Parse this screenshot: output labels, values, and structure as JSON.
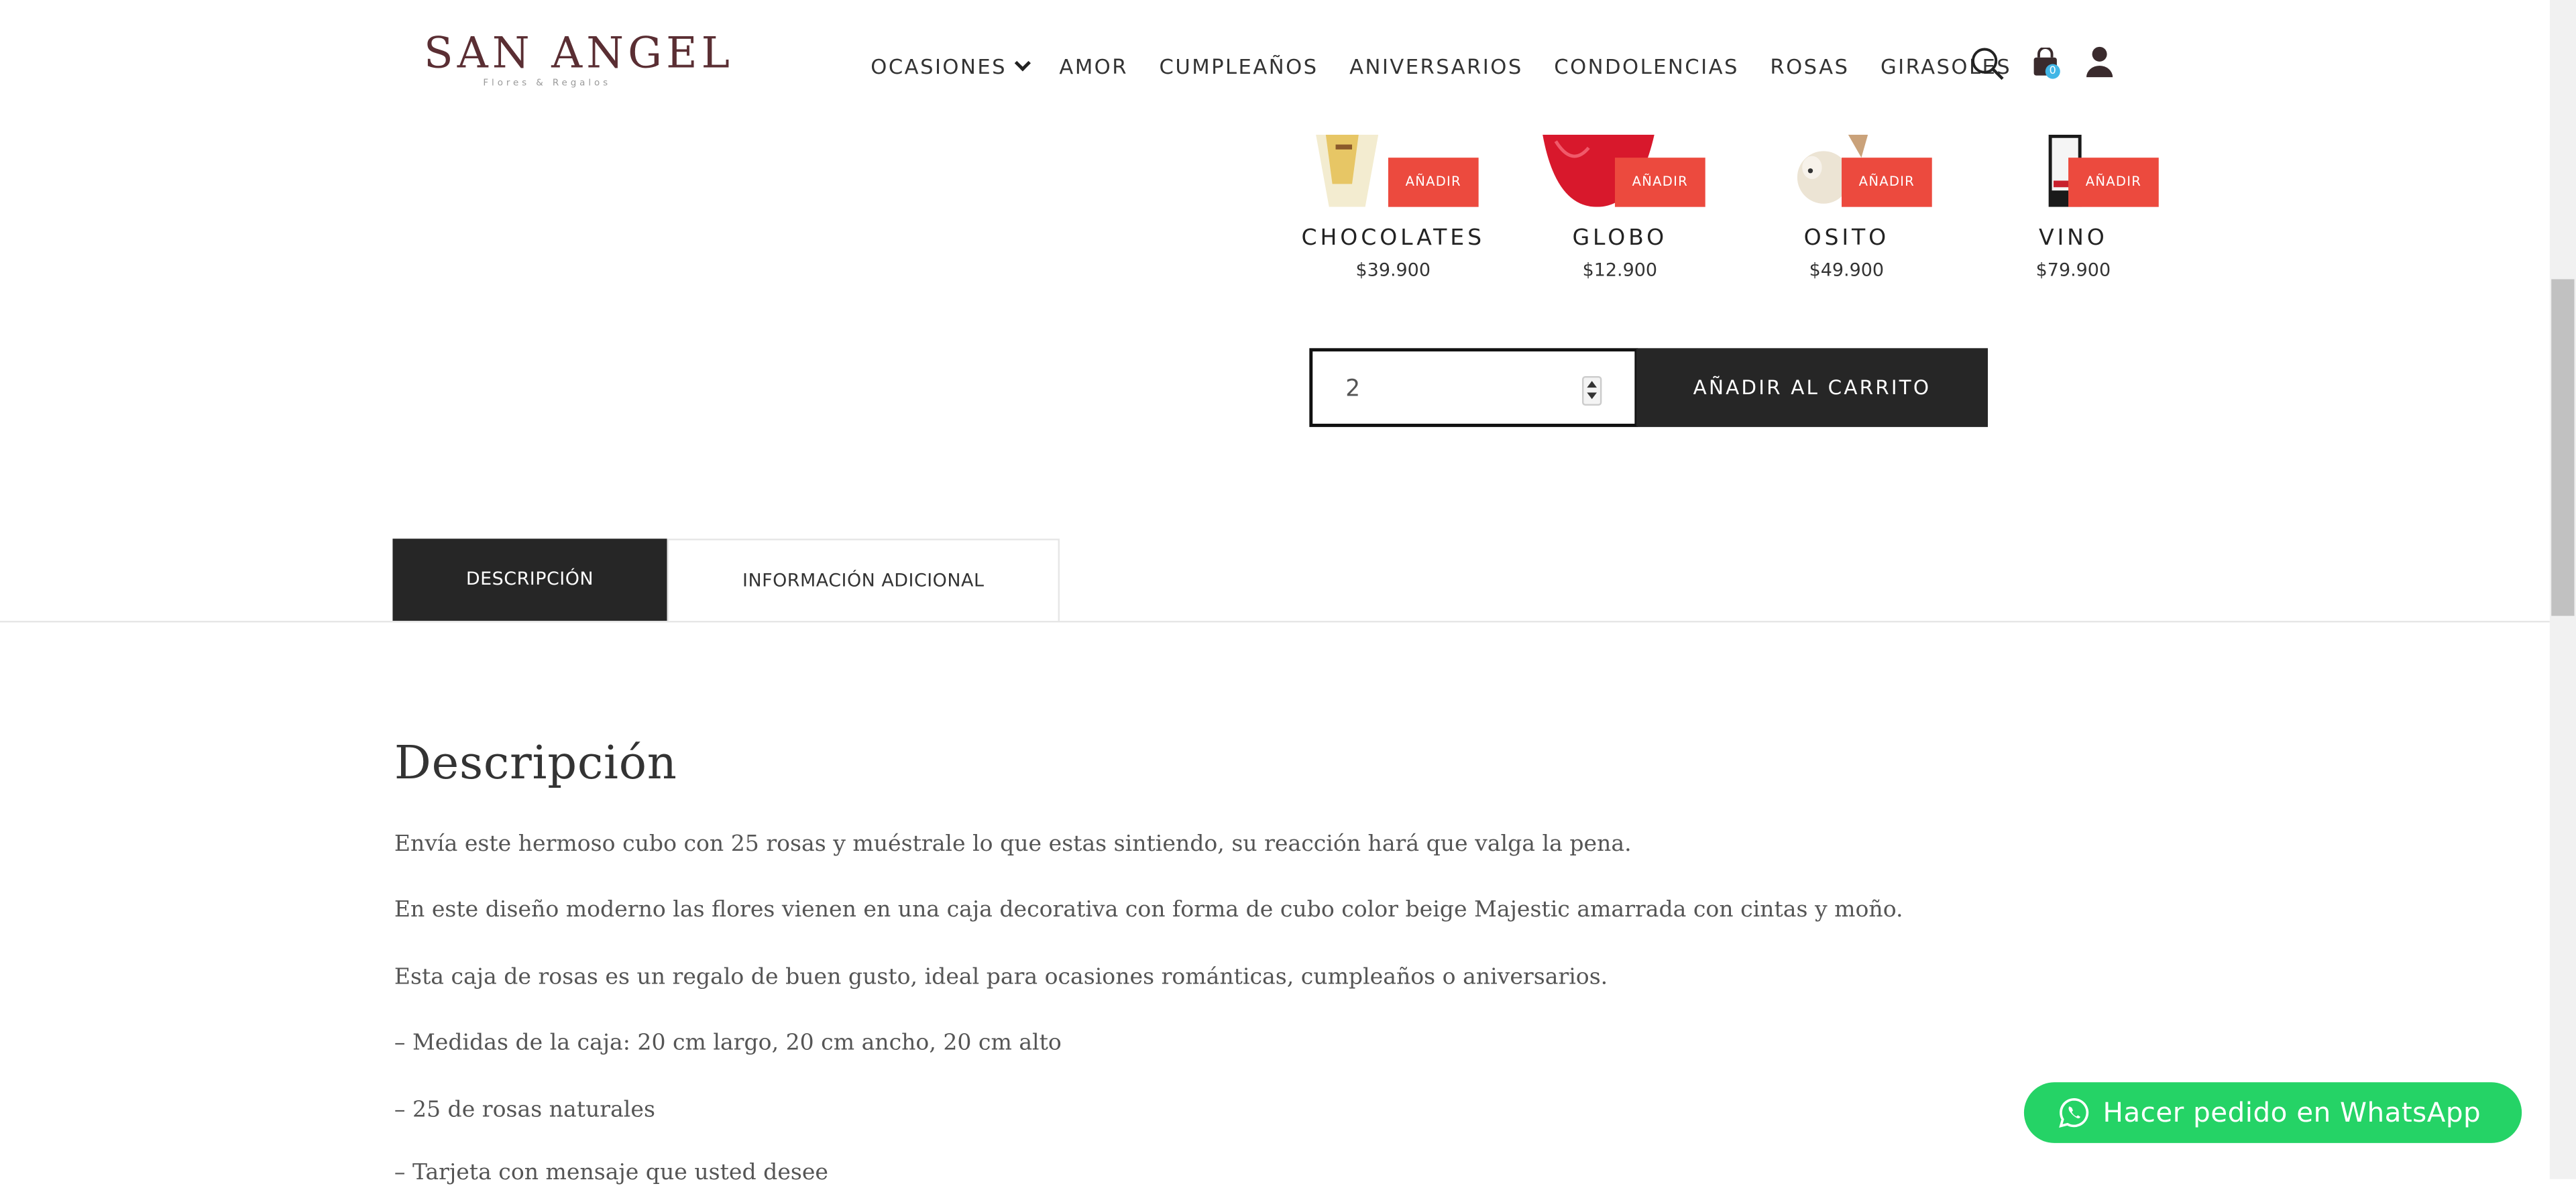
{
  "header": {
    "logo_main": "SAN ANGEL",
    "logo_sub": "Flores & Regalos",
    "nav": [
      "OCASIONES",
      "AMOR",
      "CUMPLEAÑOS",
      "ANIVERSARIOS",
      "CONDOLENCIAS",
      "ROSAS",
      "GIRASOLES"
    ],
    "cart_count": "0",
    "icons": [
      "search-icon",
      "cart-icon",
      "user-icon"
    ]
  },
  "addons": [
    {
      "name": "CHOCOLATES",
      "price": "$39.900",
      "button": "AÑADIR"
    },
    {
      "name": "GLOBO",
      "price": "$12.900",
      "button": "AÑADIR"
    },
    {
      "name": "OSITO",
      "price": "$49.900",
      "button": "AÑADIR"
    },
    {
      "name": "VINO",
      "price": "$79.900",
      "button": "AÑADIR"
    }
  ],
  "purchase": {
    "quantity": "2",
    "add_to_cart": "AÑADIR AL CARRITO"
  },
  "tabs": [
    "DESCRIPCIÓN",
    "INFORMACIÓN ADICIONAL"
  ],
  "description": {
    "title": "Descripción",
    "paragraphs": [
      "Envía este hermoso cubo con 25 rosas y muéstrale lo que estas sintiendo, su reacción hará que valga la pena.",
      "En este diseño moderno las flores vienen en una caja decorativa con forma de cubo color beige Majestic amarrada con cintas y moño.",
      "Esta caja de rosas es un regalo de buen gusto, ideal para ocasiones románticas, cumpleaños o aniversarios.",
      "– Medidas de la caja: 20 cm largo, 20 cm ancho, 20 cm alto",
      "– 25 de rosas naturales",
      "– Tarjeta con mensaje que usted desee"
    ]
  },
  "whatsapp": {
    "label": "Hacer pedido en WhatsApp"
  },
  "colors": {
    "accent": "#ec4a3e",
    "dark": "#262626",
    "whatsapp": "#25d366",
    "brand": "#5a2e33"
  }
}
